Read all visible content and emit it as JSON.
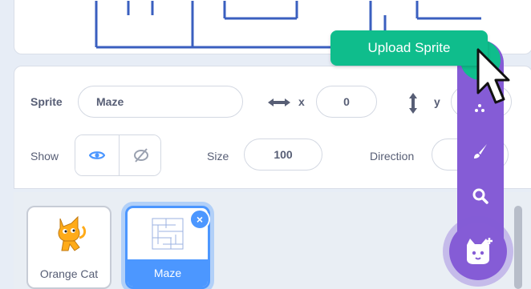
{
  "sprite_info": {
    "sprite_label": "Sprite",
    "sprite_name": "Maze",
    "x_label": "x",
    "x_value": "0",
    "y_label": "y",
    "show_label": "Show",
    "size_label": "Size",
    "size_value": "100",
    "direction_label": "Direction"
  },
  "sprites": [
    {
      "name": "Orange Cat",
      "selected": false
    },
    {
      "name": "Maze",
      "selected": true
    }
  ],
  "sprite_menu": {
    "tooltip": "Upload Sprite",
    "items": [
      "upload-icon",
      "paint-brush-icon",
      "search-icon"
    ],
    "main_icon": "cat-plus-icon"
  },
  "colors": {
    "accent_blue": "#4c97ff",
    "menu_purple": "#855cd6",
    "tooltip_green": "#0fbd8c",
    "text": "#575e75"
  }
}
